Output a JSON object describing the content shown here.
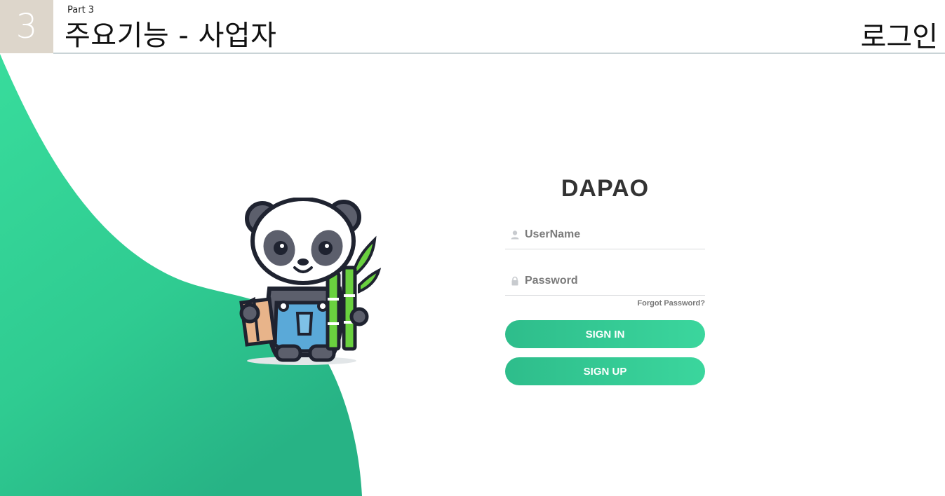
{
  "header": {
    "section_number": "3",
    "part_label": "Part 3",
    "title": "주요기능 - 사업자",
    "page_title": "로그인"
  },
  "login": {
    "brand": "DAPAO",
    "username_placeholder": "UserName",
    "password_placeholder": "Password",
    "forgot_password": "Forgot Password?",
    "sign_in_label": "SIGN IN",
    "sign_up_label": "SIGN UP"
  },
  "icons": {
    "username": "user-icon",
    "password": "lock-icon"
  },
  "colors": {
    "accent_green": "#33cf95",
    "accent_green_dark": "#26b383",
    "header_box": "#ddd6cb",
    "panda_overalls": "#5aa9d8",
    "bamboo": "#6ad13f"
  }
}
